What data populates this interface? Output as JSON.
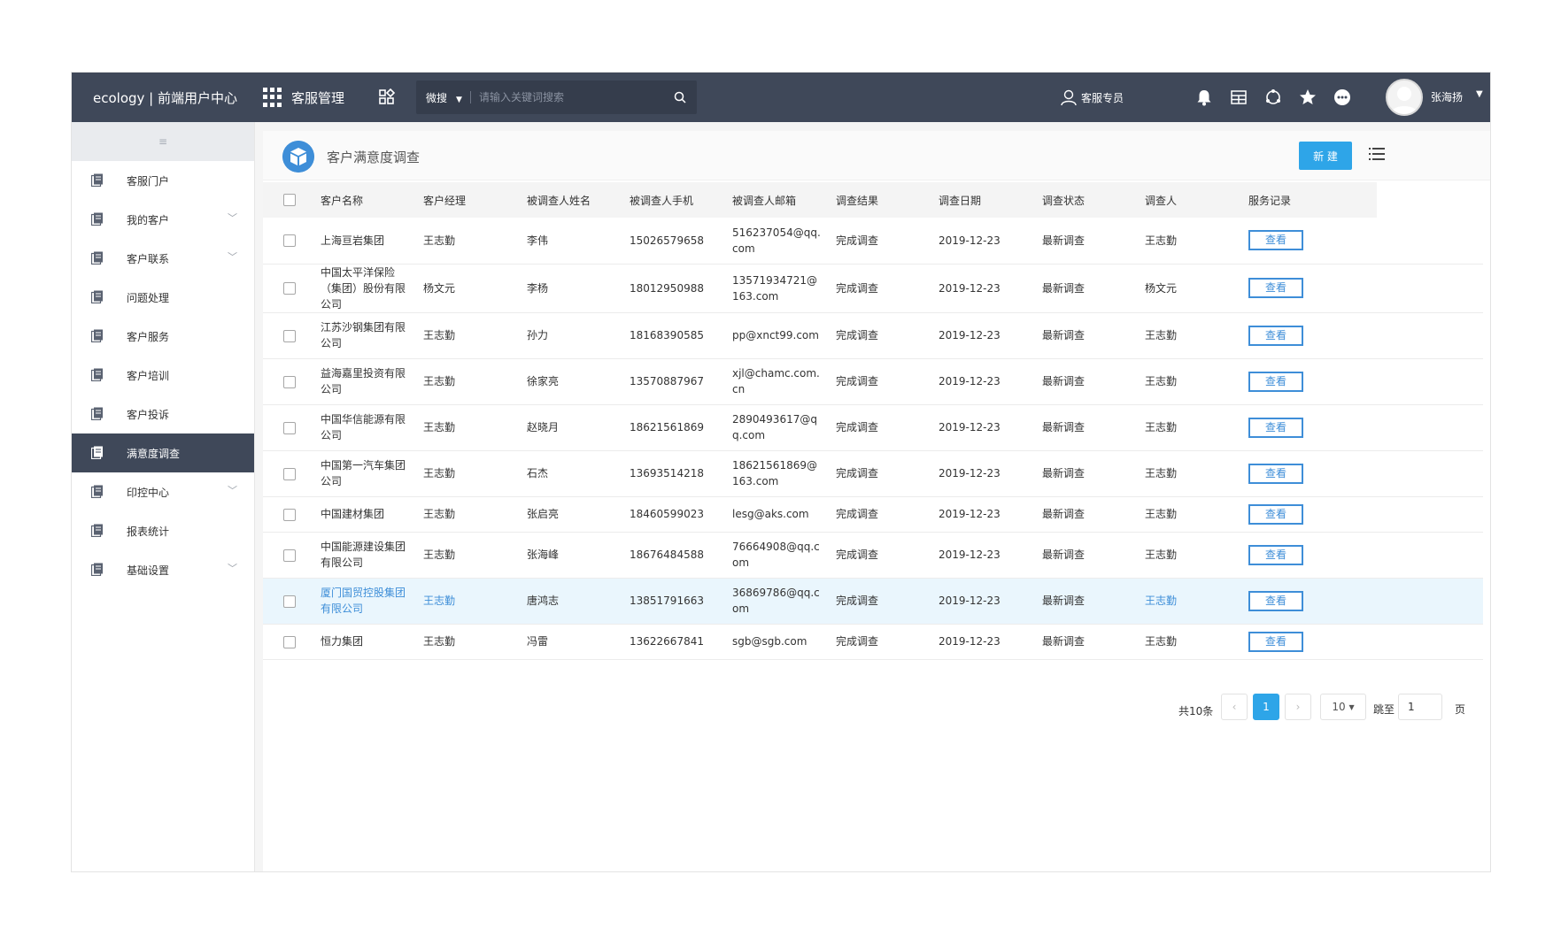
{
  "header": {
    "logo": "ecology | 前端用户中心",
    "module": "客服管理",
    "search_scope": "微搜",
    "search_placeholder": "请输入关键词搜索",
    "role": "客服专员",
    "username": "张海扬"
  },
  "sidebar": {
    "toggle": "≡",
    "items": [
      {
        "label": "客服门户",
        "expandable": false
      },
      {
        "label": "我的客户",
        "expandable": true
      },
      {
        "label": "客户联系",
        "expandable": true
      },
      {
        "label": "问题处理",
        "expandable": false
      },
      {
        "label": "客户服务",
        "expandable": false
      },
      {
        "label": "客户培训",
        "expandable": false
      },
      {
        "label": "客户投诉",
        "expandable": false
      },
      {
        "label": "满意度调查",
        "expandable": false,
        "active": true
      },
      {
        "label": "印控中心",
        "expandable": true
      },
      {
        "label": "报表统计",
        "expandable": false
      },
      {
        "label": "基础设置",
        "expandable": true
      }
    ]
  },
  "page": {
    "title": "客户满意度调查",
    "new_button": "新 建"
  },
  "table": {
    "columns": [
      "客户名称",
      "客户经理",
      "被调查人姓名",
      "被调查人手机",
      "被调查人邮箱",
      "调查结果",
      "调查日期",
      "调查状态",
      "调查人",
      "服务记录"
    ],
    "view_label": "查看",
    "rows": [
      {
        "customer": "上海亘岩集团",
        "manager": "王志勤",
        "respondent": "李伟",
        "phone": "15026579658",
        "email": "516237054@qq.com",
        "result": "完成调查",
        "date": "2019-12-23",
        "status": "最新调查",
        "surveyor": "王志勤"
      },
      {
        "customer": "中国太平洋保险（集团）股份有限公司",
        "manager": "杨文元",
        "respondent": "李杨",
        "phone": "18012950988",
        "email": "13571934721@163.com",
        "result": "完成调查",
        "date": "2019-12-23",
        "status": "最新调查",
        "surveyor": "杨文元"
      },
      {
        "customer": "江苏沙钢集团有限公司",
        "manager": "王志勤",
        "respondent": "孙力",
        "phone": "18168390585",
        "email": "pp@xnct99.com",
        "result": "完成调查",
        "date": "2019-12-23",
        "status": "最新调查",
        "surveyor": "王志勤"
      },
      {
        "customer": "益海嘉里投资有限公司",
        "manager": "王志勤",
        "respondent": "徐家亮",
        "phone": "13570887967",
        "email": "xjl@chamc.com.cn",
        "result": "完成调查",
        "date": "2019-12-23",
        "status": "最新调查",
        "surveyor": "王志勤"
      },
      {
        "customer": "中国华信能源有限公司",
        "manager": "王志勤",
        "respondent": "赵晓月",
        "phone": "18621561869",
        "email": "2890493617@qq.com",
        "result": "完成调查",
        "date": "2019-12-23",
        "status": "最新调查",
        "surveyor": "王志勤"
      },
      {
        "customer": "中国第一汽车集团公司",
        "manager": "王志勤",
        "respondent": "石杰",
        "phone": "13693514218",
        "email": "18621561869@163.com",
        "result": "完成调查",
        "date": "2019-12-23",
        "status": "最新调查",
        "surveyor": "王志勤"
      },
      {
        "customer": "中国建材集团",
        "manager": "王志勤",
        "respondent": "张启亮",
        "phone": "18460599023",
        "email": "lesg@aks.com",
        "result": "完成调查",
        "date": "2019-12-23",
        "status": "最新调查",
        "surveyor": "王志勤"
      },
      {
        "customer": "中国能源建设集团有限公司",
        "manager": "王志勤",
        "respondent": "张海峰",
        "phone": "18676484588",
        "email": "76664908@qq.com",
        "result": "完成调查",
        "date": "2019-12-23",
        "status": "最新调查",
        "surveyor": "王志勤"
      },
      {
        "customer": "厦门国贸控股集团有限公司",
        "manager": "王志勤",
        "respondent": "唐鸿志",
        "phone": "13851791663",
        "email": "36869786@qq.com",
        "result": "完成调查",
        "date": "2019-12-23",
        "status": "最新调查",
        "surveyor": "王志勤",
        "highlighted": true
      },
      {
        "customer": "恒力集团",
        "manager": "王志勤",
        "respondent": "冯雷",
        "phone": "13622667841",
        "email": "sgb@sgb.com",
        "result": "完成调查",
        "date": "2019-12-23",
        "status": "最新调查",
        "surveyor": "王志勤"
      }
    ]
  },
  "pagination": {
    "total": "共10条",
    "prev": "‹",
    "current": "1",
    "next": "›",
    "page_size": "10",
    "jump_label": "跳至",
    "jump_value": "1",
    "page_suffix": "页"
  },
  "colors": {
    "header_bg": "#3f4859",
    "accent": "#2ea5e8",
    "link": "#3e8ed8",
    "highlight_row": "#eaf6fd"
  }
}
